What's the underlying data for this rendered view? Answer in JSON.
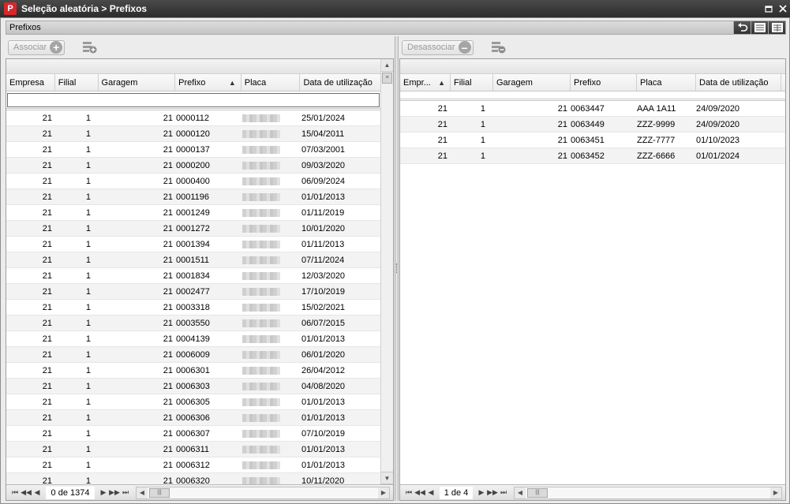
{
  "window": {
    "title": "Seleção aleatória > Prefixos",
    "logo_text": "P"
  },
  "section": {
    "label": "Prefixos"
  },
  "left": {
    "assign_button": "Associar",
    "columns": [
      "Empresa",
      "Filial",
      "Garagem",
      "Prefixo",
      "Placa",
      "Data de utilização"
    ],
    "sorted_column": "Prefixo",
    "filter_value": "",
    "rows": [
      {
        "empresa": "21",
        "filial": "1",
        "garagem": "21",
        "prefixo": "0000112",
        "data": "25/01/2024"
      },
      {
        "empresa": "21",
        "filial": "1",
        "garagem": "21",
        "prefixo": "0000120",
        "data": "15/04/2011"
      },
      {
        "empresa": "21",
        "filial": "1",
        "garagem": "21",
        "prefixo": "0000137",
        "data": "07/03/2001"
      },
      {
        "empresa": "21",
        "filial": "1",
        "garagem": "21",
        "prefixo": "0000200",
        "data": "09/03/2020"
      },
      {
        "empresa": "21",
        "filial": "1",
        "garagem": "21",
        "prefixo": "0000400",
        "data": "06/09/2024"
      },
      {
        "empresa": "21",
        "filial": "1",
        "garagem": "21",
        "prefixo": "0001196",
        "data": "01/01/2013"
      },
      {
        "empresa": "21",
        "filial": "1",
        "garagem": "21",
        "prefixo": "0001249",
        "data": "01/11/2019"
      },
      {
        "empresa": "21",
        "filial": "1",
        "garagem": "21",
        "prefixo": "0001272",
        "data": "10/01/2020"
      },
      {
        "empresa": "21",
        "filial": "1",
        "garagem": "21",
        "prefixo": "0001394",
        "data": "01/11/2013"
      },
      {
        "empresa": "21",
        "filial": "1",
        "garagem": "21",
        "prefixo": "0001511",
        "data": "07/11/2024"
      },
      {
        "empresa": "21",
        "filial": "1",
        "garagem": "21",
        "prefixo": "0001834",
        "data": "12/03/2020"
      },
      {
        "empresa": "21",
        "filial": "1",
        "garagem": "21",
        "prefixo": "0002477",
        "data": "17/10/2019"
      },
      {
        "empresa": "21",
        "filial": "1",
        "garagem": "21",
        "prefixo": "0003318",
        "data": "15/02/2021"
      },
      {
        "empresa": "21",
        "filial": "1",
        "garagem": "21",
        "prefixo": "0003550",
        "data": "06/07/2015"
      },
      {
        "empresa": "21",
        "filial": "1",
        "garagem": "21",
        "prefixo": "0004139",
        "data": "01/01/2013"
      },
      {
        "empresa": "21",
        "filial": "1",
        "garagem": "21",
        "prefixo": "0006009",
        "data": "06/01/2020"
      },
      {
        "empresa": "21",
        "filial": "1",
        "garagem": "21",
        "prefixo": "0006301",
        "data": "26/04/2012"
      },
      {
        "empresa": "21",
        "filial": "1",
        "garagem": "21",
        "prefixo": "0006303",
        "data": "04/08/2020"
      },
      {
        "empresa": "21",
        "filial": "1",
        "garagem": "21",
        "prefixo": "0006305",
        "data": "01/01/2013"
      },
      {
        "empresa": "21",
        "filial": "1",
        "garagem": "21",
        "prefixo": "0006306",
        "data": "01/01/2013"
      },
      {
        "empresa": "21",
        "filial": "1",
        "garagem": "21",
        "prefixo": "0006307",
        "data": "07/10/2019"
      },
      {
        "empresa": "21",
        "filial": "1",
        "garagem": "21",
        "prefixo": "0006311",
        "data": "01/01/2013"
      },
      {
        "empresa": "21",
        "filial": "1",
        "garagem": "21",
        "prefixo": "0006312",
        "data": "01/01/2013"
      },
      {
        "empresa": "21",
        "filial": "1",
        "garagem": "21",
        "prefixo": "0006320",
        "data": "10/11/2020"
      }
    ],
    "pager_text": "0 de 1374"
  },
  "right": {
    "unassign_button": "Desassociar",
    "columns": [
      "Empr...",
      "Filial",
      "Garagem",
      "Prefixo",
      "Placa",
      "Data de utilização"
    ],
    "sorted_column": "Empr...",
    "rows": [
      {
        "empresa": "21",
        "filial": "1",
        "garagem": "21",
        "prefixo": "0063447",
        "placa": "AAA 1A11",
        "data": "24/09/2020"
      },
      {
        "empresa": "21",
        "filial": "1",
        "garagem": "21",
        "prefixo": "0063449",
        "placa": "ZZZ-9999",
        "data": "24/09/2020"
      },
      {
        "empresa": "21",
        "filial": "1",
        "garagem": "21",
        "prefixo": "0063451",
        "placa": "ZZZ-7777",
        "data": "01/10/2023"
      },
      {
        "empresa": "21",
        "filial": "1",
        "garagem": "21",
        "prefixo": "0063452",
        "placa": "ZZZ-6666",
        "data": "01/01/2024"
      }
    ],
    "pager_text": "1 de 4"
  },
  "icons": {
    "first": "⏮",
    "prev_page": "◀◀",
    "prev": "◀",
    "next": "▶",
    "next_page": "▶▶",
    "last": "⏭"
  }
}
